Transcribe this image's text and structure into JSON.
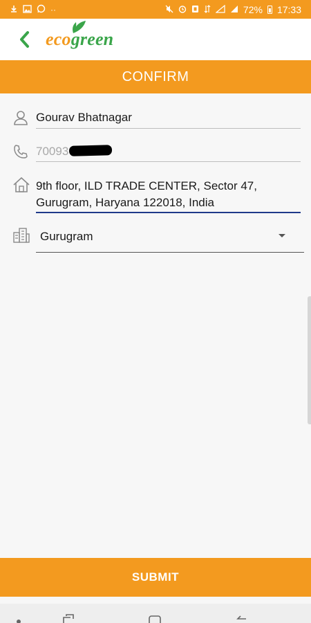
{
  "status_bar": {
    "battery": "72%",
    "time": "17:33",
    "left_icons": [
      "download-icon",
      "image-icon",
      "whatsapp-icon",
      "more-dots-icon"
    ],
    "right_icons": [
      "mute-icon",
      "alarm-icon",
      "nfc-icon",
      "data-icon",
      "lte-signal-icon",
      "signal-icon",
      "battery-icon"
    ]
  },
  "app_bar": {
    "logo_part1": "eco",
    "logo_part2": "green"
  },
  "page": {
    "title": "CONFIRM"
  },
  "form": {
    "name": "Gourav Bhatnagar",
    "phone_visible": "70093",
    "address_line1": "9th floor, ILD TRADE CENTER, Sector 47,",
    "address_line2": "Gurugram, Haryana 122018, India",
    "city_selected": "Gurugram"
  },
  "submit_label": "SUBMIT",
  "colors": {
    "primary_orange": "#f39a1f",
    "logo_green": "#3aa54a",
    "active_underline": "#1f3a8a",
    "background": "#f7f7f7"
  }
}
